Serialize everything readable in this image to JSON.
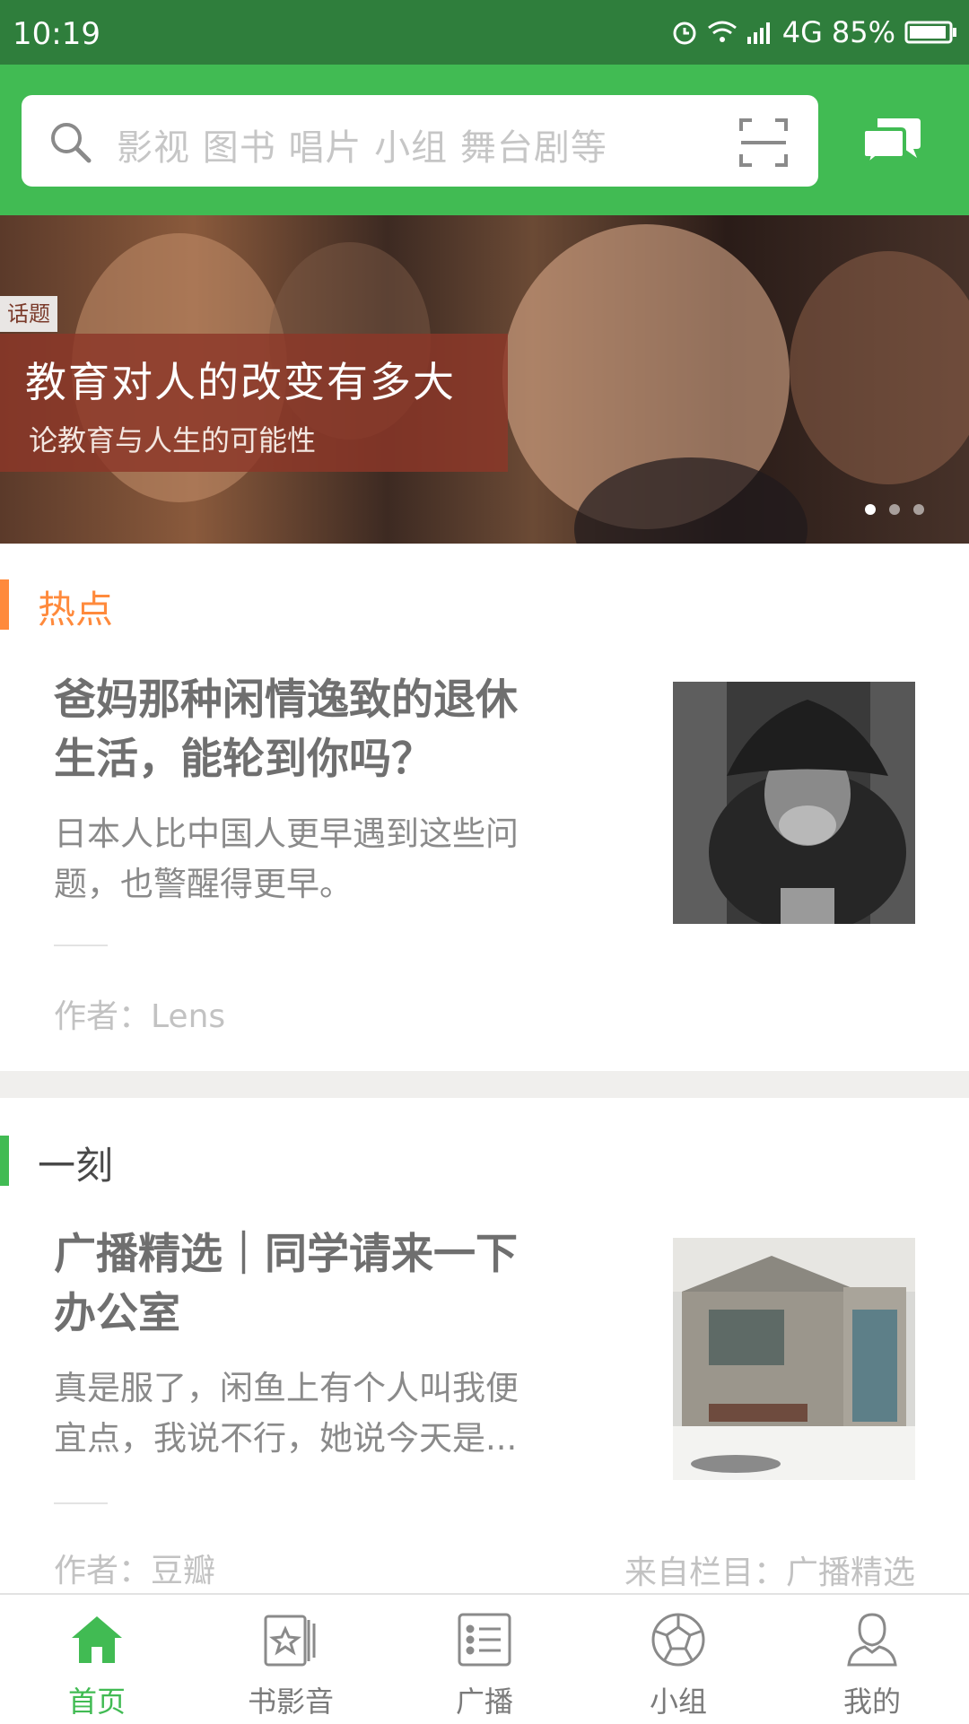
{
  "status_bar": {
    "time": "10:19",
    "network": "4G",
    "battery": "85%",
    "icons": [
      "alarm-icon",
      "wifi-icon",
      "signal-icon",
      "battery-icon"
    ]
  },
  "search": {
    "placeholder": "影视 图书 唱片 小组 舞台剧等",
    "icons": [
      "search-icon",
      "scan-icon"
    ]
  },
  "header": {
    "accent_color": "#41bb53",
    "message_icon": "chat-bubbles-icon"
  },
  "banner": {
    "tag": "话题",
    "title": "教育对人的改变有多大",
    "subtitle": "论教育与人生的可能性",
    "page_count": 3,
    "active_page": 1
  },
  "sections": [
    {
      "label": "热点",
      "accent": "#ff8a3c",
      "card": {
        "title": "爸妈那种闲情逸致的退休生活，能轮到你吗？",
        "title_lines": [
          "爸妈那种闲情逸致的退休",
          "生活，能轮到你吗？"
        ],
        "desc_lines": [
          "日本人比中国人更早遇到这些问",
          "题，也警醒得更早。"
        ],
        "author": "作者：Lens"
      }
    },
    {
      "label": "一刻",
      "accent": "#41bb53",
      "card": {
        "title_lines": [
          "广播精选｜同学请来一下",
          "办公室"
        ],
        "desc_lines": [
          "真是服了，闲鱼上有个人叫我便",
          "宜点，我说不行，她说今天是..."
        ],
        "author": "作者：豆瓣",
        "source": "来自栏目：广播精选"
      }
    }
  ],
  "tabbar": {
    "active_color": "#41bb53",
    "tabs": [
      {
        "label": "首页",
        "icon": "home-icon",
        "active": true
      },
      {
        "label": "书影音",
        "icon": "media-star-icon",
        "active": false
      },
      {
        "label": "广播",
        "icon": "list-icon",
        "active": false
      },
      {
        "label": "小组",
        "icon": "ball-icon",
        "active": false
      },
      {
        "label": "我的",
        "icon": "person-icon",
        "active": false
      }
    ]
  }
}
